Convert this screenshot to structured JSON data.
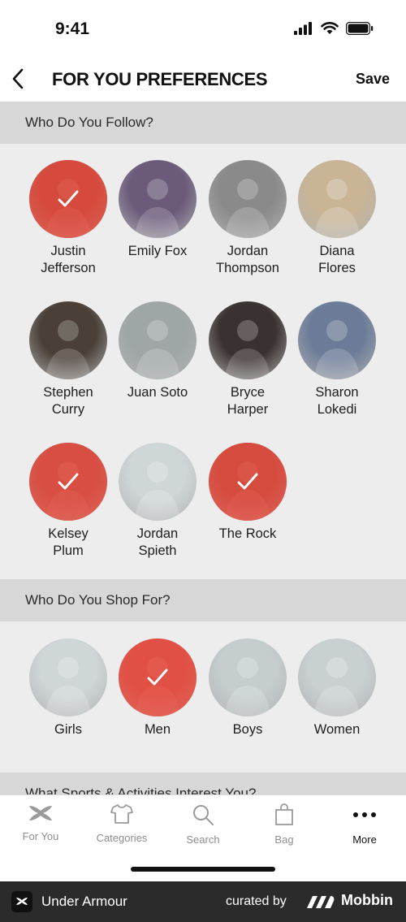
{
  "status": {
    "time": "9:41"
  },
  "nav": {
    "title": "FOR YOU PREFERENCES",
    "save_label": "Save"
  },
  "follow": {
    "title": "Who Do You Follow?",
    "items": [
      {
        "name": "Justin Jefferson",
        "selected": true,
        "color": "#8c3a2a"
      },
      {
        "name": "Emily Fox",
        "selected": false,
        "color": "#6b5a7a"
      },
      {
        "name": "Jordan Thompson",
        "selected": false,
        "color": "#8a8a8a"
      },
      {
        "name": "Diana Flores",
        "selected": false,
        "color": "#c9b596"
      },
      {
        "name": "Stephen Curry",
        "selected": false,
        "color": "#4a4038"
      },
      {
        "name": "Juan Soto",
        "selected": false,
        "color": "#9fa6a6"
      },
      {
        "name": "Bryce Harper",
        "selected": false,
        "color": "#3a3230"
      },
      {
        "name": "Sharon Lokedi",
        "selected": false,
        "color": "#6c7c98"
      },
      {
        "name": "Kelsey Plum",
        "selected": true,
        "color": "#9b4a40"
      },
      {
        "name": "Jordan Spieth",
        "selected": false,
        "color": "#cfd6d8"
      },
      {
        "name": "The Rock",
        "selected": true,
        "color": "#8e3d30"
      }
    ]
  },
  "shop": {
    "title": "Who Do You Shop For?",
    "items": [
      {
        "name": "Girls",
        "selected": false,
        "color": "#cfd6d8"
      },
      {
        "name": "Men",
        "selected": true,
        "color": "#c5524a"
      },
      {
        "name": "Boys",
        "selected": false,
        "color": "#c5cdcf"
      },
      {
        "name": "Women",
        "selected": false,
        "color": "#c9d0d2"
      }
    ]
  },
  "sports": {
    "title": "What Sports & Activities Interest You?"
  },
  "tabs": [
    {
      "label": "For You",
      "icon": "under-armour-logo-icon",
      "active": false
    },
    {
      "label": "Categories",
      "icon": "shirt-icon",
      "active": false
    },
    {
      "label": "Search",
      "icon": "search-icon",
      "active": false
    },
    {
      "label": "Bag",
      "icon": "bag-icon",
      "active": false
    },
    {
      "label": "More",
      "icon": "more-dots-icon",
      "active": true
    }
  ],
  "footer": {
    "brand": "Under Armour",
    "curated": "curated by",
    "mobbin": "Mobbin"
  },
  "colors": {
    "accent": "#e95042",
    "header_bg": "#d7d7d7",
    "page_bg": "#ededed"
  }
}
